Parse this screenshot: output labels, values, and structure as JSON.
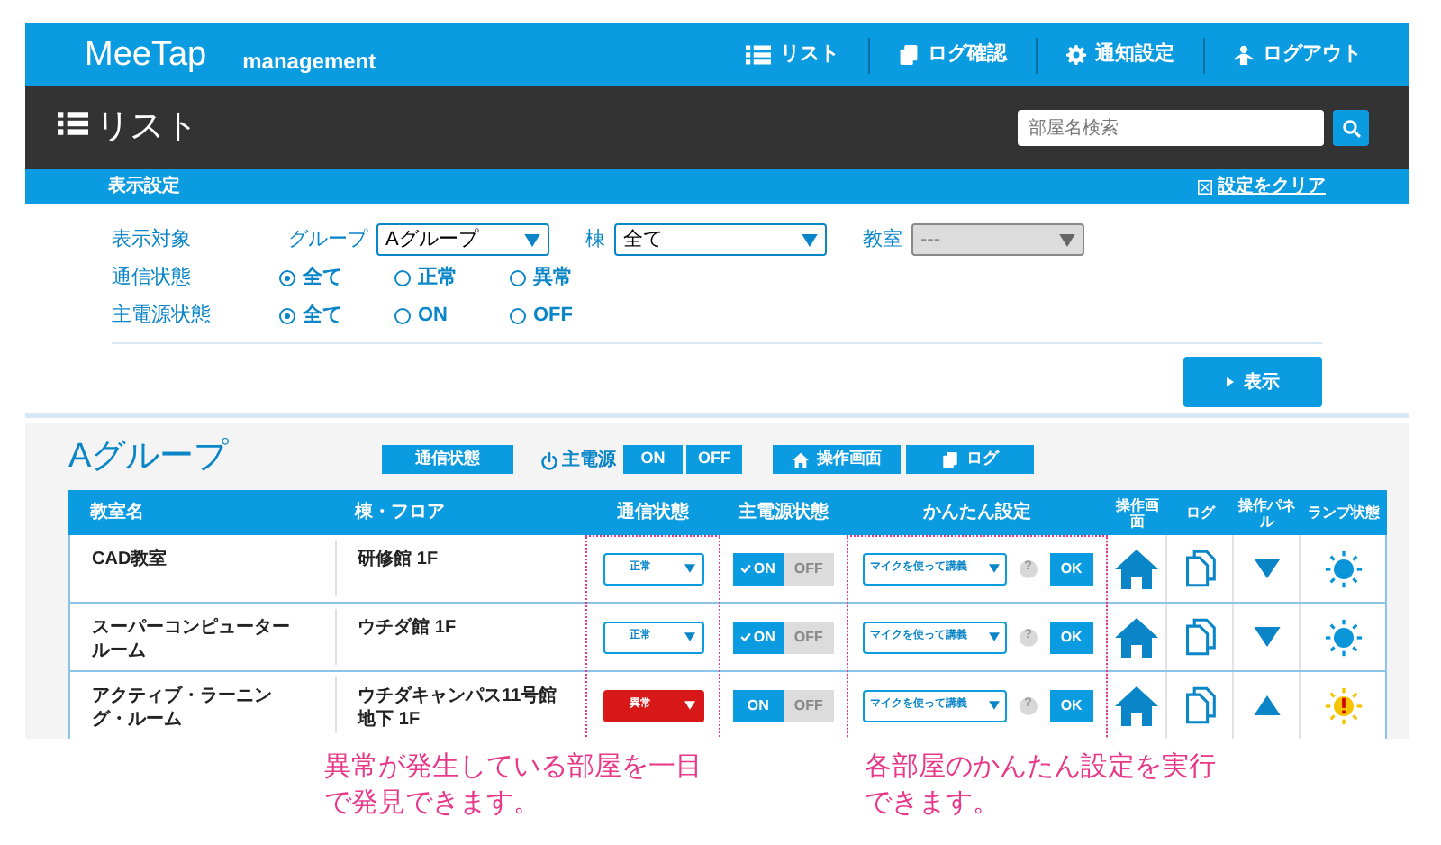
{
  "header": {
    "brand": "MeeTap",
    "subtitle": "management",
    "nav": [
      {
        "label": "リスト"
      },
      {
        "label": "ログ確認"
      },
      {
        "label": "通知設定"
      },
      {
        "label": "ログアウト"
      }
    ]
  },
  "toolbar": {
    "title": "リスト",
    "search": {
      "placeholder": "部屋名検索"
    }
  },
  "settings_bar": {
    "title": "表示設定",
    "clear_link": "設定をクリア"
  },
  "filters": {
    "target_label": "表示対象",
    "selects": [
      {
        "label": "グループ",
        "value": "Aグループ",
        "disabled": false
      },
      {
        "label": "棟",
        "value": "全て",
        "disabled": false
      },
      {
        "label": "教室",
        "value": "---",
        "disabled": true
      }
    ],
    "radio_groups": [
      {
        "label": "通信状態",
        "options": [
          {
            "label": "全て",
            "selected": true
          },
          {
            "label": "正常",
            "selected": false
          },
          {
            "label": "異常",
            "selected": false
          }
        ]
      },
      {
        "label": "主電源状態",
        "options": [
          {
            "label": "全て",
            "selected": true
          },
          {
            "label": "ON",
            "selected": false
          },
          {
            "label": "OFF",
            "selected": false
          }
        ]
      }
    ],
    "show_button": "表示"
  },
  "group": {
    "title": "Aグループ",
    "comm_button": "通信状態",
    "power_label": "主電源",
    "power_on": "ON",
    "power_off": "OFF",
    "screen_button": "操作画面",
    "log_button": "ログ"
  },
  "table": {
    "columns": [
      "教室名",
      "棟・フロア",
      "通信状態",
      "主電源状態",
      "かんたん設定",
      "操作画面",
      "ログ",
      "操作パネル",
      "ランプ状態"
    ],
    "rows": [
      {
        "name": "CAD教室",
        "floor": "研修館 1F",
        "comm": {
          "value": "正常",
          "error": false
        },
        "power": {
          "on": "ON",
          "off": "OFF",
          "checked": true
        },
        "preset": "マイクを使って講義",
        "help": "?",
        "ok": "OK",
        "panel_expanded": false,
        "lamp_warning": false
      },
      {
        "name": "スーパーコンピュータールーム",
        "floor": "ウチダ館 1F",
        "comm": {
          "value": "正常",
          "error": false
        },
        "power": {
          "on": "ON",
          "off": "OFF",
          "checked": true
        },
        "preset": "マイクを使って講義",
        "help": "?",
        "ok": "OK",
        "panel_expanded": false,
        "lamp_warning": false
      },
      {
        "name": "アクティブ・ラーニング・ルーム",
        "floor": "ウチダキャンパス11号館地下 1F",
        "comm": {
          "value": "異常",
          "error": true
        },
        "power": {
          "on": "ON",
          "off": "OFF",
          "checked": false
        },
        "preset": "マイクを使って講義",
        "help": "?",
        "ok": "OK",
        "panel_expanded": true,
        "lamp_warning": true
      }
    ]
  },
  "annotations": [
    "異常が発生している部屋を一目で発見できます。",
    "各部屋のかんたん設定を実行できます。"
  ]
}
